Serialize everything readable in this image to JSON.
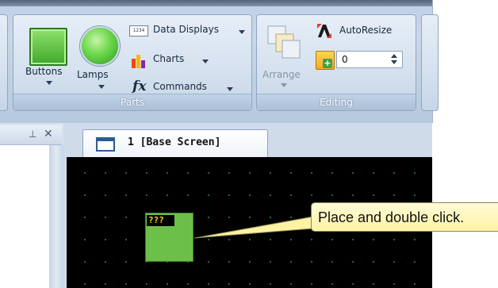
{
  "ribbon": {
    "parts_group": {
      "caption": "Parts",
      "buttons_label": "Buttons",
      "lamps_label": "Lamps",
      "data_displays_label": "Data Displays",
      "charts_label": "Charts",
      "commands_label": "Commands",
      "data_displays_icon_text": "1234",
      "commands_icon_text": "fx"
    },
    "editing_group": {
      "caption": "Editing",
      "arrange_label": "Arrange",
      "autoresize_label": "AutoResize",
      "spinner_value": "0"
    }
  },
  "editor": {
    "tab_label": "1 [Base Screen]",
    "lamp_tag_text": "???",
    "callout_text": "Place and double click."
  },
  "colors": {
    "lamp_fill": "#6cc04a",
    "screen_background": "#000000",
    "callout_fill": "#fff2a4"
  },
  "icons": {
    "pin": "pin-icon",
    "close": "close-icon"
  }
}
